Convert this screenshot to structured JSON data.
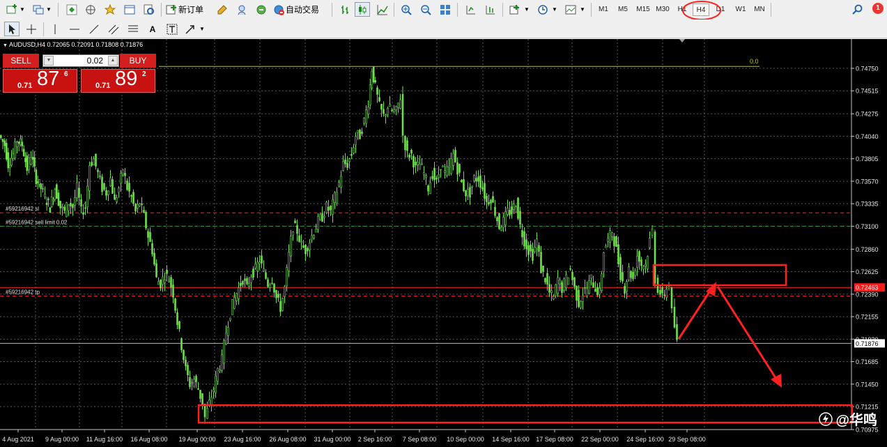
{
  "toolbar": {
    "new_order": "新订单",
    "auto_trading": "自动交易",
    "timeframes": [
      "M1",
      "M5",
      "M15",
      "M30",
      "H1",
      "H4",
      "D1",
      "W1",
      "MN"
    ],
    "active_timeframe": "H4",
    "alert_count": "1"
  },
  "chart_header": {
    "symbol": "AUDUSD,H4",
    "ohlc": "0.72065 0.72091 0.71808 0.71876"
  },
  "trade_panel": {
    "sell_label": "SELL",
    "buy_label": "BUY",
    "lot_value": "0.02",
    "bid": {
      "prefix": "0.71",
      "big": "87",
      "small": "6"
    },
    "ask": {
      "prefix": "0.71",
      "big": "89",
      "small": "2"
    }
  },
  "watermark": {
    "text": "@华鸣"
  },
  "chart_data": {
    "type": "candlestick",
    "symbol": "AUDUSD",
    "timeframe": "H4",
    "ylim": [
      0.70975,
      0.7483
    ],
    "y_ticks": [
      "0.74750",
      "0.74515",
      "0.74275",
      "0.74040",
      "0.73805",
      "0.73570",
      "0.73335",
      "0.73100",
      "0.72860",
      "0.72625",
      "0.72390",
      "0.72155",
      "0.71920",
      "0.71685",
      "0.71450",
      "0.71215",
      "0.70975"
    ],
    "x_ticks": [
      "4 Aug 2021",
      "9 Aug 00:00",
      "11 Aug 16:00",
      "16 Aug 08:00",
      "19 Aug 00:00",
      "23 Aug 16:00",
      "26 Aug 08:00",
      "31 Aug 00:00",
      "2 Sep 16:00",
      "7 Sep 08:00",
      "10 Sep 00:00",
      "14 Sep 16:00",
      "17 Sep 08:00",
      "22 Sep 00:00",
      "24 Sep 16:00",
      "29 Sep 08:00"
    ],
    "grid": true,
    "current_price": 0.71876,
    "current_price_label": "0.71876",
    "marker_price_label": "0.72463",
    "fib_label": "0.0",
    "fib_level": 0.7477,
    "order_lines": [
      {
        "label": "#59216942 sl",
        "price": 0.7324,
        "color": "#ff2222",
        "style": "dashed"
      },
      {
        "label": "#59216942 sell limit 0.02",
        "price": 0.731,
        "color": "#2f9a2f",
        "style": "dashed"
      },
      {
        "label": "#59216942 tp",
        "price": 0.7237,
        "color": "#ff2222",
        "style": "dashed"
      },
      {
        "label": "",
        "price": 0.7246,
        "color": "#ff2222",
        "style": "solid"
      }
    ],
    "close_path": [
      [
        0,
        0.7405
      ],
      [
        8,
        0.7395
      ],
      [
        13,
        0.7375
      ],
      [
        20,
        0.7385
      ],
      [
        26,
        0.74
      ],
      [
        33,
        0.7395
      ],
      [
        40,
        0.737
      ],
      [
        46,
        0.7385
      ],
      [
        53,
        0.736
      ],
      [
        60,
        0.735
      ],
      [
        66,
        0.734
      ],
      [
        73,
        0.733
      ],
      [
        80,
        0.735
      ],
      [
        88,
        0.733
      ],
      [
        94,
        0.7325
      ],
      [
        100,
        0.7335
      ],
      [
        106,
        0.733
      ],
      [
        112,
        0.735
      ],
      [
        118,
        0.7325
      ],
      [
        124,
        0.733
      ],
      [
        130,
        0.7375
      ],
      [
        136,
        0.738
      ],
      [
        142,
        0.7365
      ],
      [
        148,
        0.735
      ],
      [
        154,
        0.7345
      ],
      [
        160,
        0.736
      ],
      [
        166,
        0.7335
      ],
      [
        172,
        0.735
      ],
      [
        178,
        0.737
      ],
      [
        184,
        0.735
      ],
      [
        190,
        0.734
      ],
      [
        196,
        0.7325
      ],
      [
        202,
        0.7335
      ],
      [
        208,
        0.732
      ],
      [
        214,
        0.73
      ],
      [
        220,
        0.7285
      ],
      [
        226,
        0.7255
      ],
      [
        232,
        0.725
      ],
      [
        238,
        0.726
      ],
      [
        244,
        0.7255
      ],
      [
        250,
        0.724
      ],
      [
        256,
        0.721
      ],
      [
        262,
        0.7185
      ],
      [
        268,
        0.716
      ],
      [
        274,
        0.7145
      ],
      [
        280,
        0.715
      ],
      [
        286,
        0.714
      ],
      [
        292,
        0.7125
      ],
      [
        296,
        0.711
      ],
      [
        302,
        0.7125
      ],
      [
        308,
        0.714
      ],
      [
        314,
        0.716
      ],
      [
        320,
        0.717
      ],
      [
        326,
        0.72
      ],
      [
        332,
        0.722
      ],
      [
        338,
        0.7235
      ],
      [
        344,
        0.7245
      ],
      [
        350,
        0.7255
      ],
      [
        356,
        0.7245
      ],
      [
        362,
        0.726
      ],
      [
        368,
        0.7265
      ],
      [
        374,
        0.7275
      ],
      [
        380,
        0.7262
      ],
      [
        386,
        0.725
      ],
      [
        392,
        0.7255
      ],
      [
        398,
        0.7235
      ],
      [
        404,
        0.7225
      ],
      [
        410,
        0.7245
      ],
      [
        416,
        0.728
      ],
      [
        422,
        0.731
      ],
      [
        428,
        0.7305
      ],
      [
        434,
        0.729
      ],
      [
        440,
        0.7285
      ],
      [
        446,
        0.7295
      ],
      [
        452,
        0.7305
      ],
      [
        458,
        0.7315
      ],
      [
        464,
        0.732
      ],
      [
        470,
        0.733
      ],
      [
        476,
        0.7325
      ],
      [
        482,
        0.734
      ],
      [
        488,
        0.7355
      ],
      [
        494,
        0.7375
      ],
      [
        500,
        0.7375
      ],
      [
        506,
        0.7385
      ],
      [
        512,
        0.7405
      ],
      [
        518,
        0.7405
      ],
      [
        524,
        0.742
      ],
      [
        530,
        0.744
      ],
      [
        535,
        0.7475
      ],
      [
        540,
        0.7455
      ],
      [
        546,
        0.7435
      ],
      [
        552,
        0.7425
      ],
      [
        558,
        0.7435
      ],
      [
        564,
        0.743
      ],
      [
        570,
        0.743
      ],
      [
        576,
        0.7445
      ],
      [
        580,
        0.7405
      ],
      [
        586,
        0.7385
      ],
      [
        592,
        0.7385
      ],
      [
        598,
        0.737
      ],
      [
        604,
        0.7375
      ],
      [
        610,
        0.7365
      ],
      [
        616,
        0.735
      ],
      [
        622,
        0.7365
      ],
      [
        628,
        0.7355
      ],
      [
        634,
        0.7375
      ],
      [
        640,
        0.7365
      ],
      [
        646,
        0.737
      ],
      [
        652,
        0.7385
      ],
      [
        658,
        0.737
      ],
      [
        664,
        0.7355
      ],
      [
        670,
        0.7345
      ],
      [
        676,
        0.7345
      ],
      [
        682,
        0.736
      ],
      [
        688,
        0.736
      ],
      [
        694,
        0.735
      ],
      [
        700,
        0.7335
      ],
      [
        706,
        0.734
      ],
      [
        712,
        0.7325
      ],
      [
        718,
        0.731
      ],
      [
        724,
        0.7315
      ],
      [
        730,
        0.7325
      ],
      [
        736,
        0.7325
      ],
      [
        742,
        0.7335
      ],
      [
        748,
        0.731
      ],
      [
        754,
        0.7295
      ],
      [
        760,
        0.7285
      ],
      [
        766,
        0.728
      ],
      [
        772,
        0.7295
      ],
      [
        778,
        0.7265
      ],
      [
        784,
        0.7255
      ],
      [
        790,
        0.724
      ],
      [
        796,
        0.7235
      ],
      [
        802,
        0.7255
      ],
      [
        808,
        0.7245
      ],
      [
        814,
        0.7255
      ],
      [
        820,
        0.7265
      ],
      [
        826,
        0.7245
      ],
      [
        832,
        0.723
      ],
      [
        838,
        0.724
      ],
      [
        844,
        0.7245
      ],
      [
        850,
        0.7255
      ],
      [
        856,
        0.7245
      ],
      [
        862,
        0.724
      ],
      [
        868,
        0.7285
      ],
      [
        874,
        0.7295
      ],
      [
        880,
        0.7305
      ],
      [
        886,
        0.7285
      ],
      [
        892,
        0.726
      ],
      [
        898,
        0.7245
      ],
      [
        904,
        0.7265
      ],
      [
        910,
        0.7255
      ],
      [
        916,
        0.728
      ],
      [
        922,
        0.727
      ],
      [
        928,
        0.727
      ],
      [
        934,
        0.7295
      ],
      [
        938,
        0.7305
      ],
      [
        942,
        0.7255
      ],
      [
        946,
        0.7245
      ],
      [
        952,
        0.7235
      ],
      [
        958,
        0.7245
      ],
      [
        962,
        0.725
      ],
      [
        966,
        0.722
      ],
      [
        970,
        0.7205
      ],
      [
        973,
        0.7188
      ]
    ]
  }
}
